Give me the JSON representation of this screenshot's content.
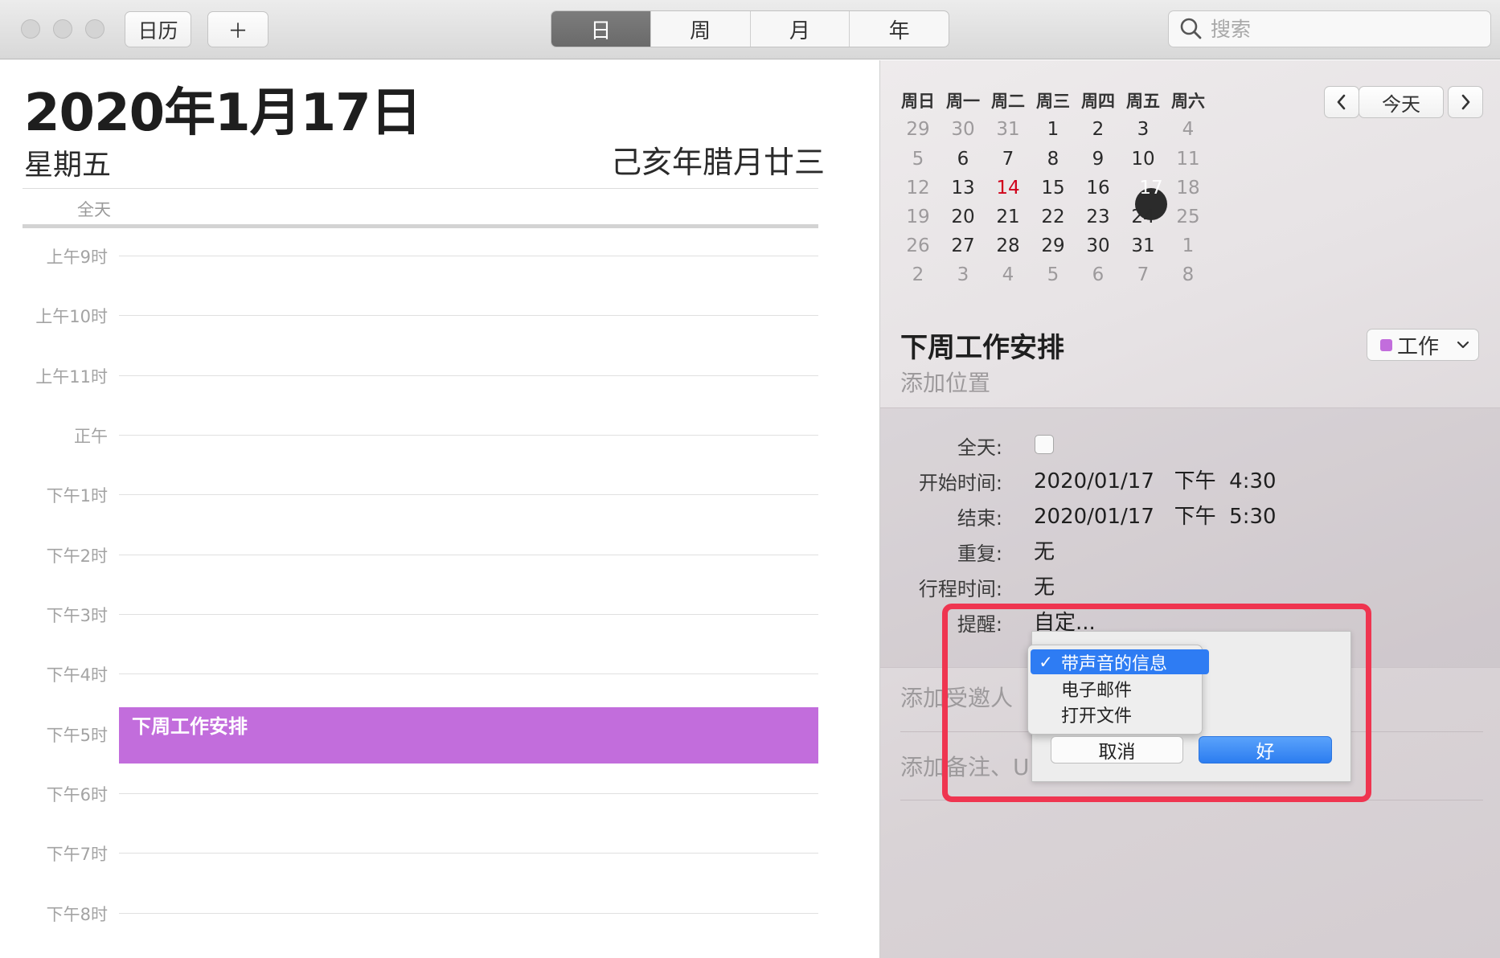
{
  "toolbar": {
    "calendars_label": "日历",
    "add_label": "＋",
    "view_tabs": [
      "日",
      "周",
      "月",
      "年"
    ],
    "active_tab": "日",
    "search_placeholder": "搜索"
  },
  "day_view": {
    "title": "2020年1月17日",
    "weekday": "星期五",
    "lunar": "己亥年腊月廿三",
    "allday_label": "全天",
    "hours": [
      "上午9时",
      "上午10时",
      "上午11时",
      "正午",
      "下午1时",
      "下午2时",
      "下午3时",
      "下午4时",
      "下午5时",
      "下午6时",
      "下午7时",
      "下午8时"
    ],
    "event_title": "下周工作安排"
  },
  "mini_calendar": {
    "weekdays": [
      "周日",
      "周一",
      "周二",
      "周三",
      "周四",
      "周五",
      "周六"
    ],
    "weeks": [
      [
        "29",
        "30",
        "31",
        "1",
        "2",
        "3",
        "4"
      ],
      [
        "5",
        "6",
        "7",
        "8",
        "9",
        "10",
        "11"
      ],
      [
        "12",
        "13",
        "14",
        "15",
        "16",
        "17",
        "18"
      ],
      [
        "19",
        "20",
        "21",
        "22",
        "23",
        "24",
        "25"
      ],
      [
        "26",
        "27",
        "28",
        "29",
        "30",
        "31",
        "1"
      ],
      [
        "2",
        "3",
        "4",
        "5",
        "6",
        "7",
        "8"
      ]
    ],
    "today": "14",
    "selected": "17",
    "today_color": "#d0021b",
    "nav_prev": "‹",
    "nav_today": "今天",
    "nav_next": "›"
  },
  "event": {
    "title": "下周工作安排",
    "location_placeholder": "添加位置",
    "calendar": "工作",
    "calendar_color": "#c26ddc",
    "allday_label": "全天:",
    "start_label": "开始时间:",
    "start_value": "2020/01/17   下午  4:30",
    "end_label": "结束:",
    "end_value": "2020/01/17   下午  5:30",
    "repeat_label": "重复:",
    "repeat_value": "无",
    "travel_label": "行程时间:",
    "travel_value": "无",
    "alert_label": "提醒:",
    "alert_value": "自定...",
    "invitees_placeholder": "添加受邀人",
    "notes_placeholder": "添加备注、U"
  },
  "alert_sheet": {
    "options": [
      "带声音的信息",
      "电子邮件",
      "打开文件"
    ],
    "selected_option": "带声音的信息",
    "cancel_label": "取消",
    "ok_label": "好",
    "ok_color": "#2c7df0"
  },
  "annotation_color": "#ef3550"
}
